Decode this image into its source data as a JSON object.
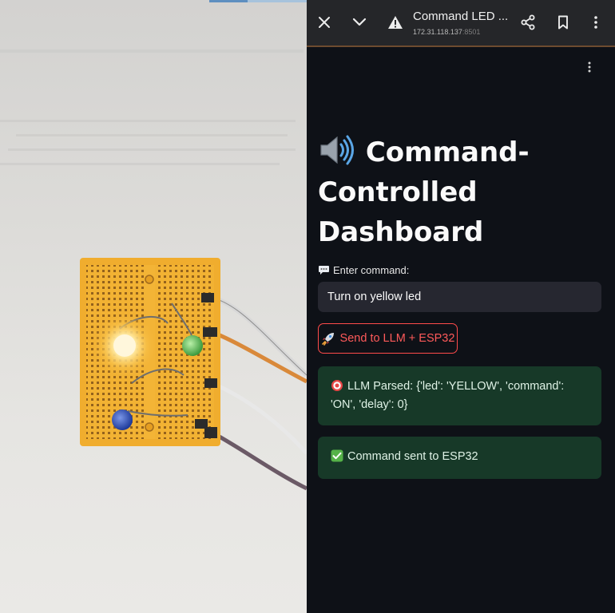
{
  "browser": {
    "tab_title": "Command LED ...",
    "url_host": "172.31.118.137",
    "url_port": ":8501"
  },
  "icons": {
    "close": "close-icon",
    "collapse": "chevron-down-icon",
    "security": "warning-triangle-icon",
    "share": "share-icon",
    "bookmark": "bookmark-icon",
    "menu": "kebab-menu-icon",
    "title_emoji": "speaker-icon",
    "label_emoji": "speech-bubble-icon",
    "button_emoji": "rocket-icon",
    "parsed_emoji": "target-icon",
    "success_emoji": "check-box-icon"
  },
  "app": {
    "title": "Command-Controlled Dashboard",
    "command_label": "Enter command:",
    "command_value": "Turn on yellow led",
    "send_button_label": "Send to LLM + ESP32",
    "parsed_message": "LLM Parsed: {'led': 'YELLOW', 'command': 'ON', 'delay': 0}",
    "success_message": "Command sent to ESP32"
  },
  "colors": {
    "app_background": "#0e1117",
    "accent_red": "#ff4b4b",
    "success_background": "#173928",
    "input_background": "#262730",
    "toolbar_background": "#252629"
  }
}
